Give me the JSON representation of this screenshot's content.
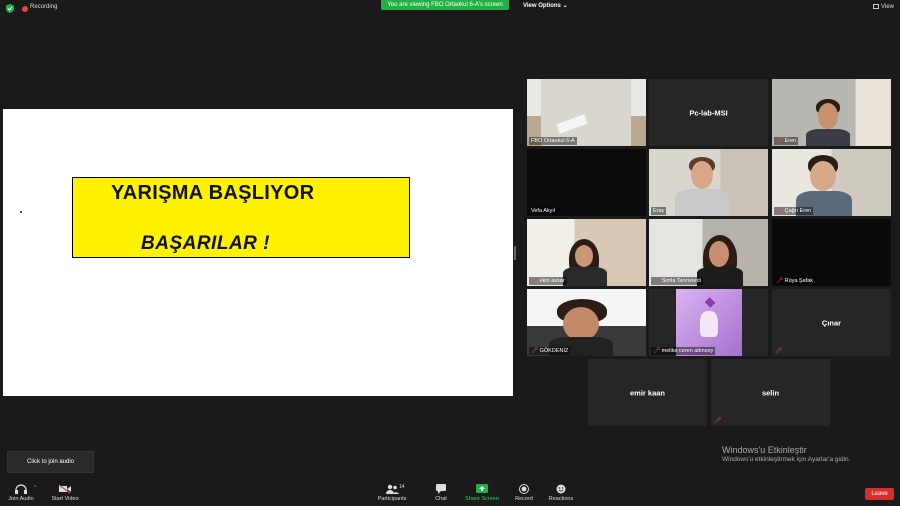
{
  "topbar": {
    "recording_label": "Recording",
    "viewing_banner": "You are viewing FBO Ortaokul 6-A's screen",
    "view_options": "View Options",
    "view_label": "View"
  },
  "colors": {
    "banner_green": "#23b146",
    "leave_red": "#d4302b",
    "muted_red": "#e34a41",
    "slide_yellow": "#fff200",
    "active_speaker": "#c6cf4e"
  },
  "slide": {
    "line1": "YARIŞMA BAŞLIYOR",
    "line2": "BAŞARILAR !"
  },
  "participants": [
    {
      "name": "FBO Ortaokul 6-A",
      "video": true,
      "muted": false
    },
    {
      "name": "Pc-lab-MSI",
      "video": false,
      "muted": false
    },
    {
      "name": "Eren",
      "video": true,
      "muted": true
    },
    {
      "name": "Vefa Akyıl",
      "video": true,
      "muted": false
    },
    {
      "name": "Eray",
      "video": true,
      "muted": false,
      "active": true
    },
    {
      "name": "Çağrı Eren",
      "video": true,
      "muted": true
    },
    {
      "name": "ekin avsar",
      "video": true,
      "muted": true
    },
    {
      "name": "Simla Tanrıverdi",
      "video": true,
      "muted": true
    },
    {
      "name": "Rüya Şafak",
      "video": true,
      "muted": true
    },
    {
      "name": "GÖKDENİZ",
      "video": true,
      "muted": true
    },
    {
      "name": "melike ceren altınsoy",
      "video": true,
      "muted": true
    },
    {
      "name": "Çınar",
      "video": false,
      "muted": true
    },
    {
      "name": "emir kaan",
      "video": false,
      "muted": false
    },
    {
      "name": "selin",
      "video": false,
      "muted": true
    }
  ],
  "notifications": {
    "join_audio_popup": "Click to join audio",
    "windows_title": "Windows'u Etkinleştir",
    "windows_sub": "Windows'u etkinleştirmek için Ayarlar'a gidin."
  },
  "toolbar": {
    "join_audio": "Join Audio",
    "start_video": "Start Video",
    "participants": "Participants",
    "participants_count": "14",
    "chat": "Chat",
    "share_screen": "Share Screen",
    "record": "Record",
    "reactions": "Reactions",
    "leave": "Leave"
  },
  "icons": [
    "shield-icon",
    "recording-dot-icon",
    "chevron-down-icon",
    "grid-view-icon",
    "mic-muted-icon",
    "headphones-icon",
    "video-off-icon",
    "participants-icon",
    "chat-icon",
    "share-screen-icon",
    "record-icon",
    "reactions-icon"
  ]
}
